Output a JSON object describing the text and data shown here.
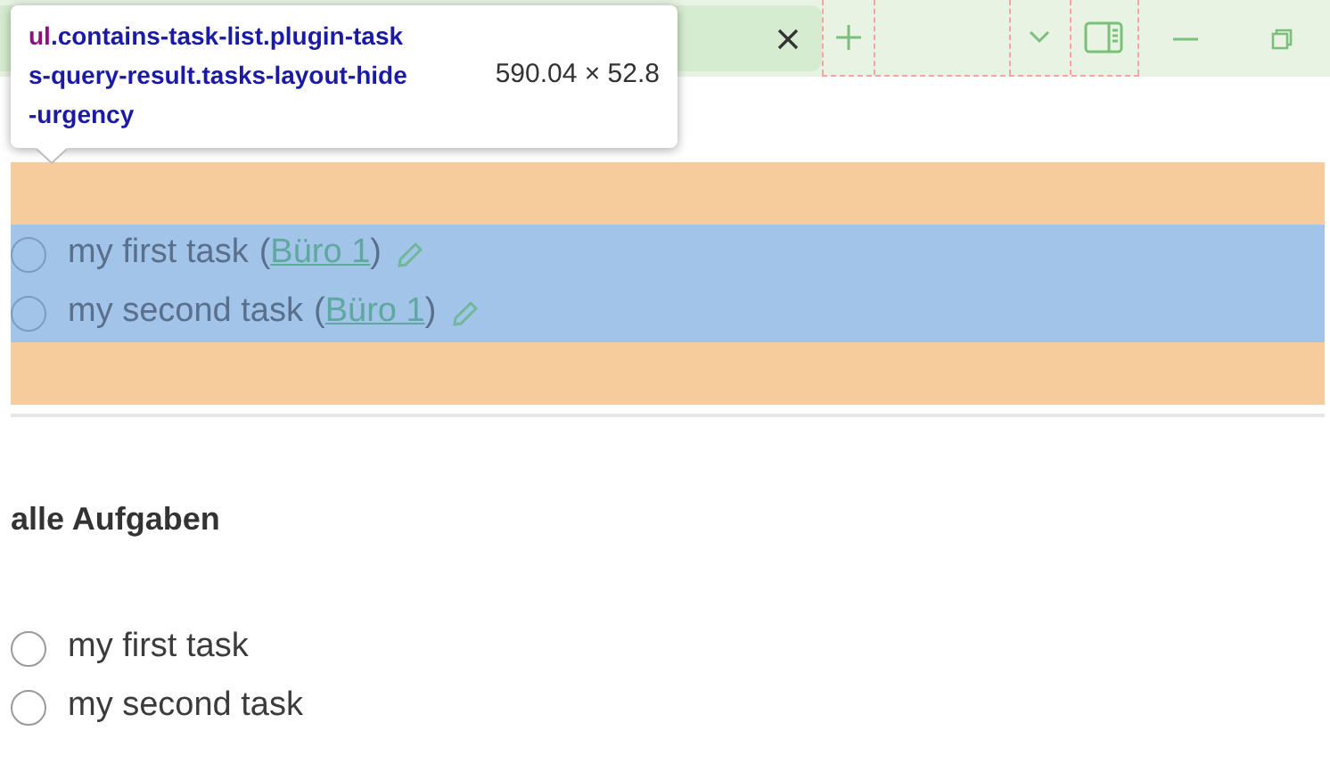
{
  "tooltip": {
    "selector_tag": "ul",
    "selector_lines": [
      ".contains-task-list.plugin-task",
      "s-query-result.tasks-layout-hide",
      "-urgency"
    ],
    "size": "590.04 × 52.8"
  },
  "sections": [
    {
      "highlighted": true,
      "tasks": [
        {
          "text": "my first task",
          "link_open": "(",
          "link": "Büro 1",
          "link_close": ")",
          "checked": false
        },
        {
          "text": "my second task",
          "link_open": "(",
          "link": "Büro 1",
          "link_close": ")",
          "checked": false
        }
      ]
    },
    {
      "heading": "alle Aufgaben",
      "highlighted": false,
      "tasks": [
        {
          "text": "my first task",
          "checked": false
        },
        {
          "text": "my second task",
          "checked": false
        }
      ]
    }
  ]
}
